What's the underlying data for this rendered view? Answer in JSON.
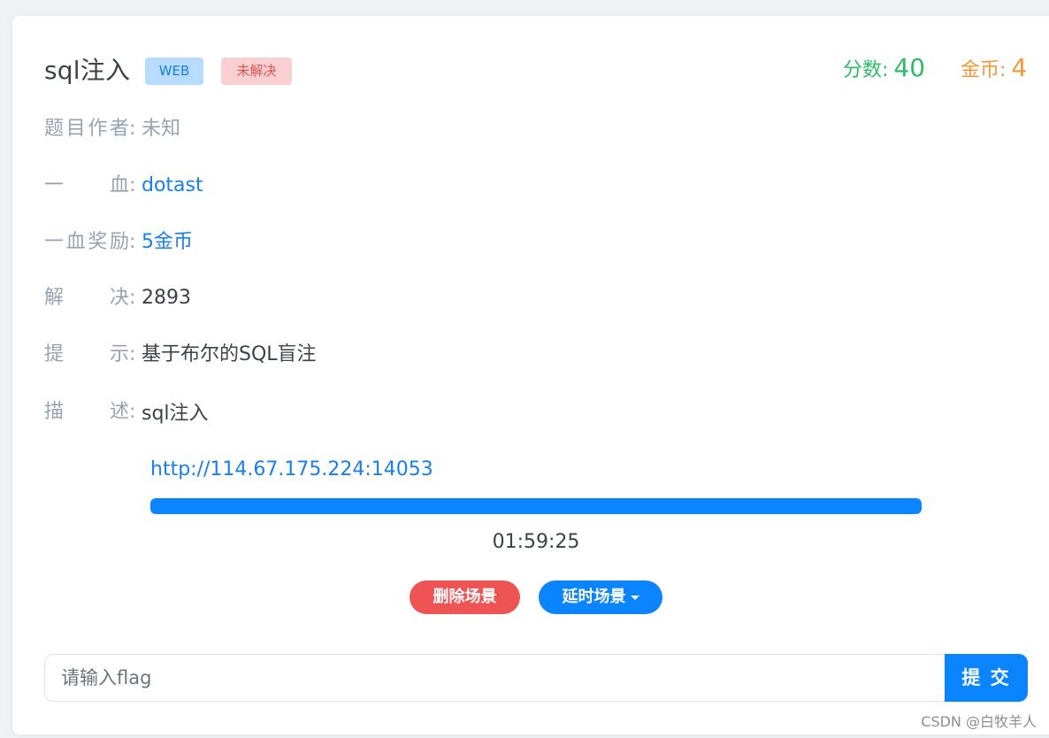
{
  "challenge": {
    "title": "sql注入",
    "category_tag": "WEB",
    "status_tag": "未解决",
    "score_label": "分数:",
    "score_value": "40",
    "coin_label": "金币:",
    "coin_value": "4"
  },
  "details": {
    "author": {
      "label_chars": [
        "题",
        "目",
        "作",
        "者"
      ],
      "colon": ":",
      "value": "未知"
    },
    "first_blood": {
      "label_chars": [
        "一",
        "血"
      ],
      "colon": ":",
      "value": "dotast"
    },
    "first_blood_reward": {
      "label_chars": [
        "一",
        "血",
        "奖",
        "励"
      ],
      "colon": ":",
      "value": "5金币"
    },
    "solves": {
      "label_chars": [
        "解",
        "决"
      ],
      "colon": ":",
      "value": "2893"
    },
    "hint": {
      "label_chars": [
        "提",
        "示"
      ],
      "colon": ":",
      "value": "基于布尔的SQL盲注"
    },
    "description": {
      "label_chars": [
        "描",
        "述"
      ],
      "colon": ":",
      "value": "sql注入"
    }
  },
  "scene": {
    "url": "http://114.67.175.224:14053",
    "progress_percent": 100,
    "timer": "01:59:25",
    "delete_button": "删除场景",
    "delay_button": "延时场景"
  },
  "submit": {
    "placeholder": "请输入flag",
    "value": "",
    "button_label": "提 交"
  },
  "watermark": "CSDN @白牧羊人",
  "colors": {
    "accent_blue": "#0a84ff",
    "link_blue": "#1a7fe6",
    "score_green": "#2fbb67",
    "coin_orange": "#f0993b",
    "danger_red": "#ef5454",
    "label_gray": "#98a2b3"
  }
}
